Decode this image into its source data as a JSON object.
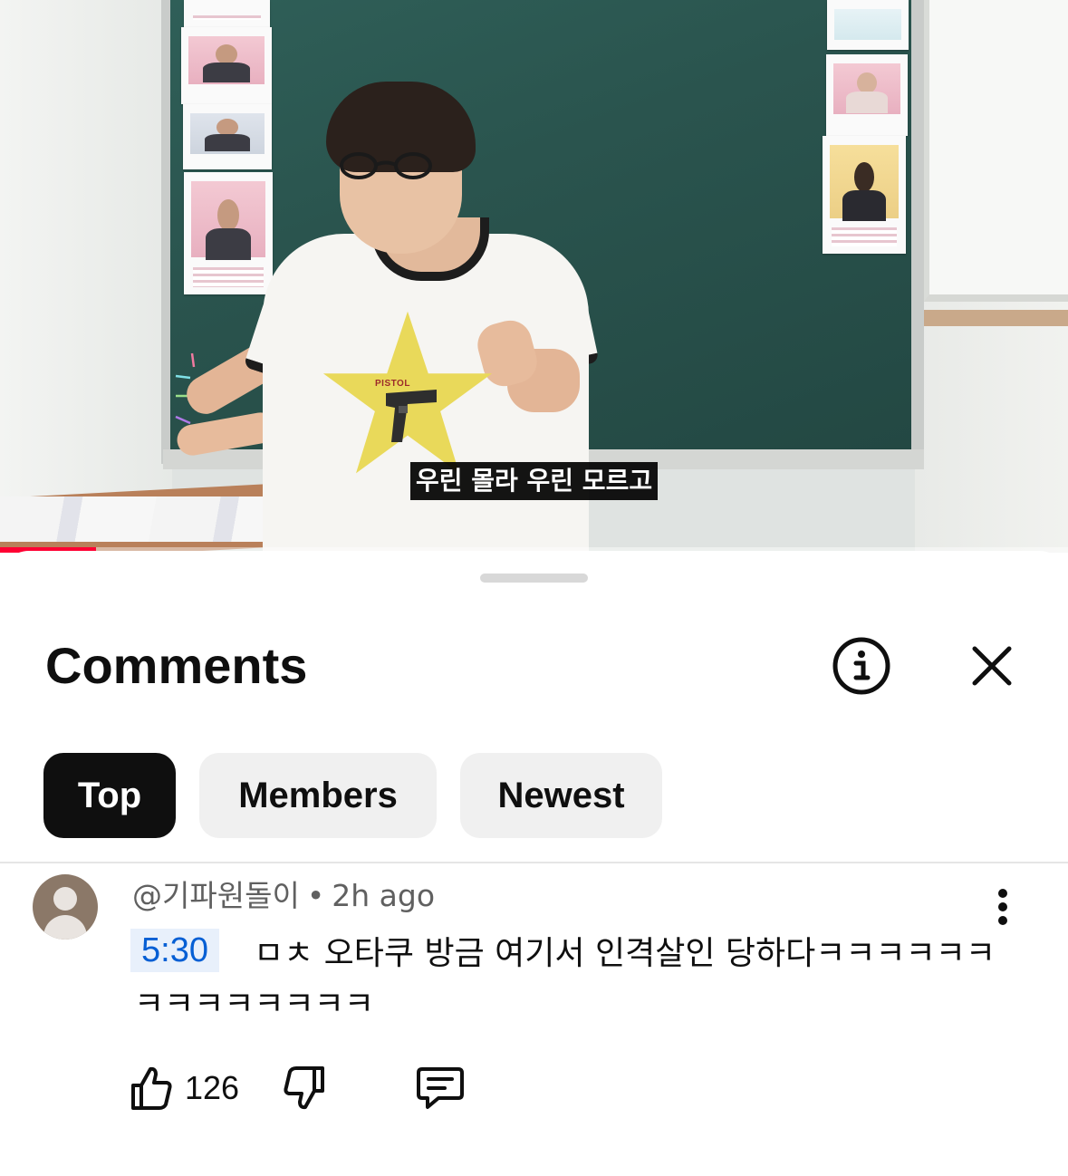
{
  "video": {
    "subtitle": "우린 몰라 우린 모르고",
    "shirt_text": "PISTOL",
    "progress_fraction": 0.09
  },
  "sheet": {
    "title": "Comments",
    "info_icon": "info-circle-icon",
    "close_icon": "close-icon"
  },
  "filters": [
    {
      "label": "Top",
      "active": true
    },
    {
      "label": "Members",
      "active": false
    },
    {
      "label": "Newest",
      "active": false
    }
  ],
  "comment": {
    "author": "@기파원돌이",
    "separator": "•",
    "time": "2h ago",
    "timestamp_link": "5:30",
    "text": "ㅁㅊ 오타쿠 방금 여기서 인격살인 당하다ㅋㅋㅋㅋㅋㅋㅋㅋㅋㅋㅋㅋㅋㅋ",
    "likes": "126"
  },
  "colors": {
    "accent_link": "#065fd4",
    "timestamp_bg": "#e8f0fb",
    "progress": "#ff0033",
    "chip_active": "#0f0f0f",
    "chip_inactive": "#f0f0f0"
  }
}
